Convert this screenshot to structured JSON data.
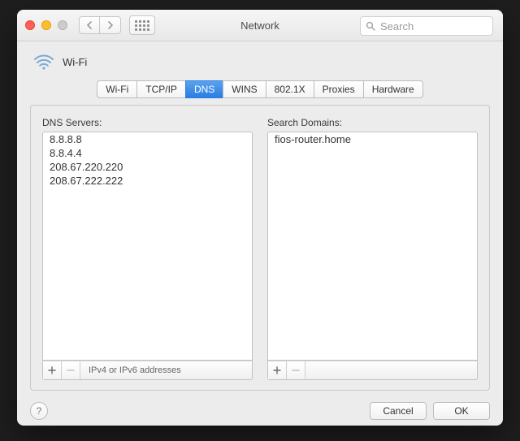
{
  "window": {
    "title": "Network"
  },
  "search": {
    "placeholder": "Search"
  },
  "header": {
    "interface": "Wi-Fi"
  },
  "tabs": {
    "items": [
      "Wi-Fi",
      "TCP/IP",
      "DNS",
      "WINS",
      "802.1X",
      "Proxies",
      "Hardware"
    ],
    "active": "DNS"
  },
  "dns": {
    "left_label": "DNS Servers:",
    "servers": [
      "8.8.8.8",
      "8.8.4.4",
      "208.67.220.220",
      "208.67.222.222"
    ],
    "hint": "IPv4 or IPv6 addresses",
    "right_label": "Search Domains:",
    "domains": [
      "fios-router.home"
    ]
  },
  "buttons": {
    "cancel": "Cancel",
    "ok": "OK"
  },
  "icons": {
    "wifi": "wifi-icon",
    "search": "search-icon",
    "back": "chevron-left-icon",
    "forward": "chevron-right-icon",
    "grid": "grid-icon",
    "help": "help-icon",
    "add": "plus-icon",
    "remove": "minus-icon"
  }
}
